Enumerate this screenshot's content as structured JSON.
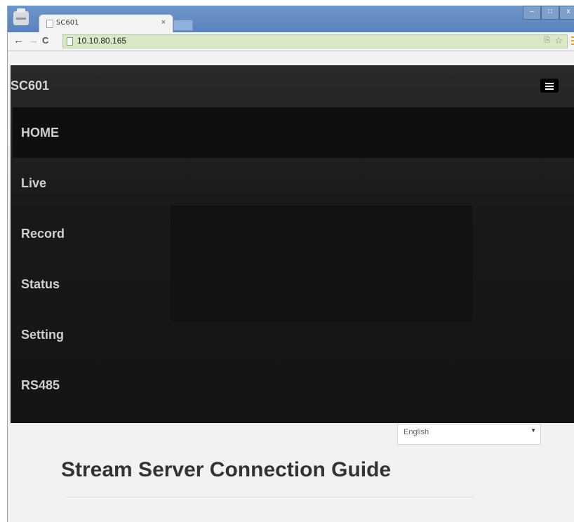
{
  "browser": {
    "tab_title": "SC601",
    "tab_close": "×",
    "url": "10.10.80.165",
    "back_glyph": "←",
    "forward_glyph": "→",
    "reload_glyph": "C",
    "win_min": "–",
    "win_max": "□",
    "win_close": "x"
  },
  "app": {
    "brand": "SC601",
    "nav": [
      "HOME",
      "Live",
      "Record",
      "Status",
      "Setting",
      "RS485"
    ],
    "active_nav": "HOME",
    "language": "English",
    "heading": "Stream Server Connection Guide"
  },
  "icons": [
    "printer-icon",
    "page-icon",
    "close-icon",
    "translate-icon",
    "star-icon",
    "menu-icon",
    "hamburger-icon",
    "dropdown-arrow-icon"
  ]
}
